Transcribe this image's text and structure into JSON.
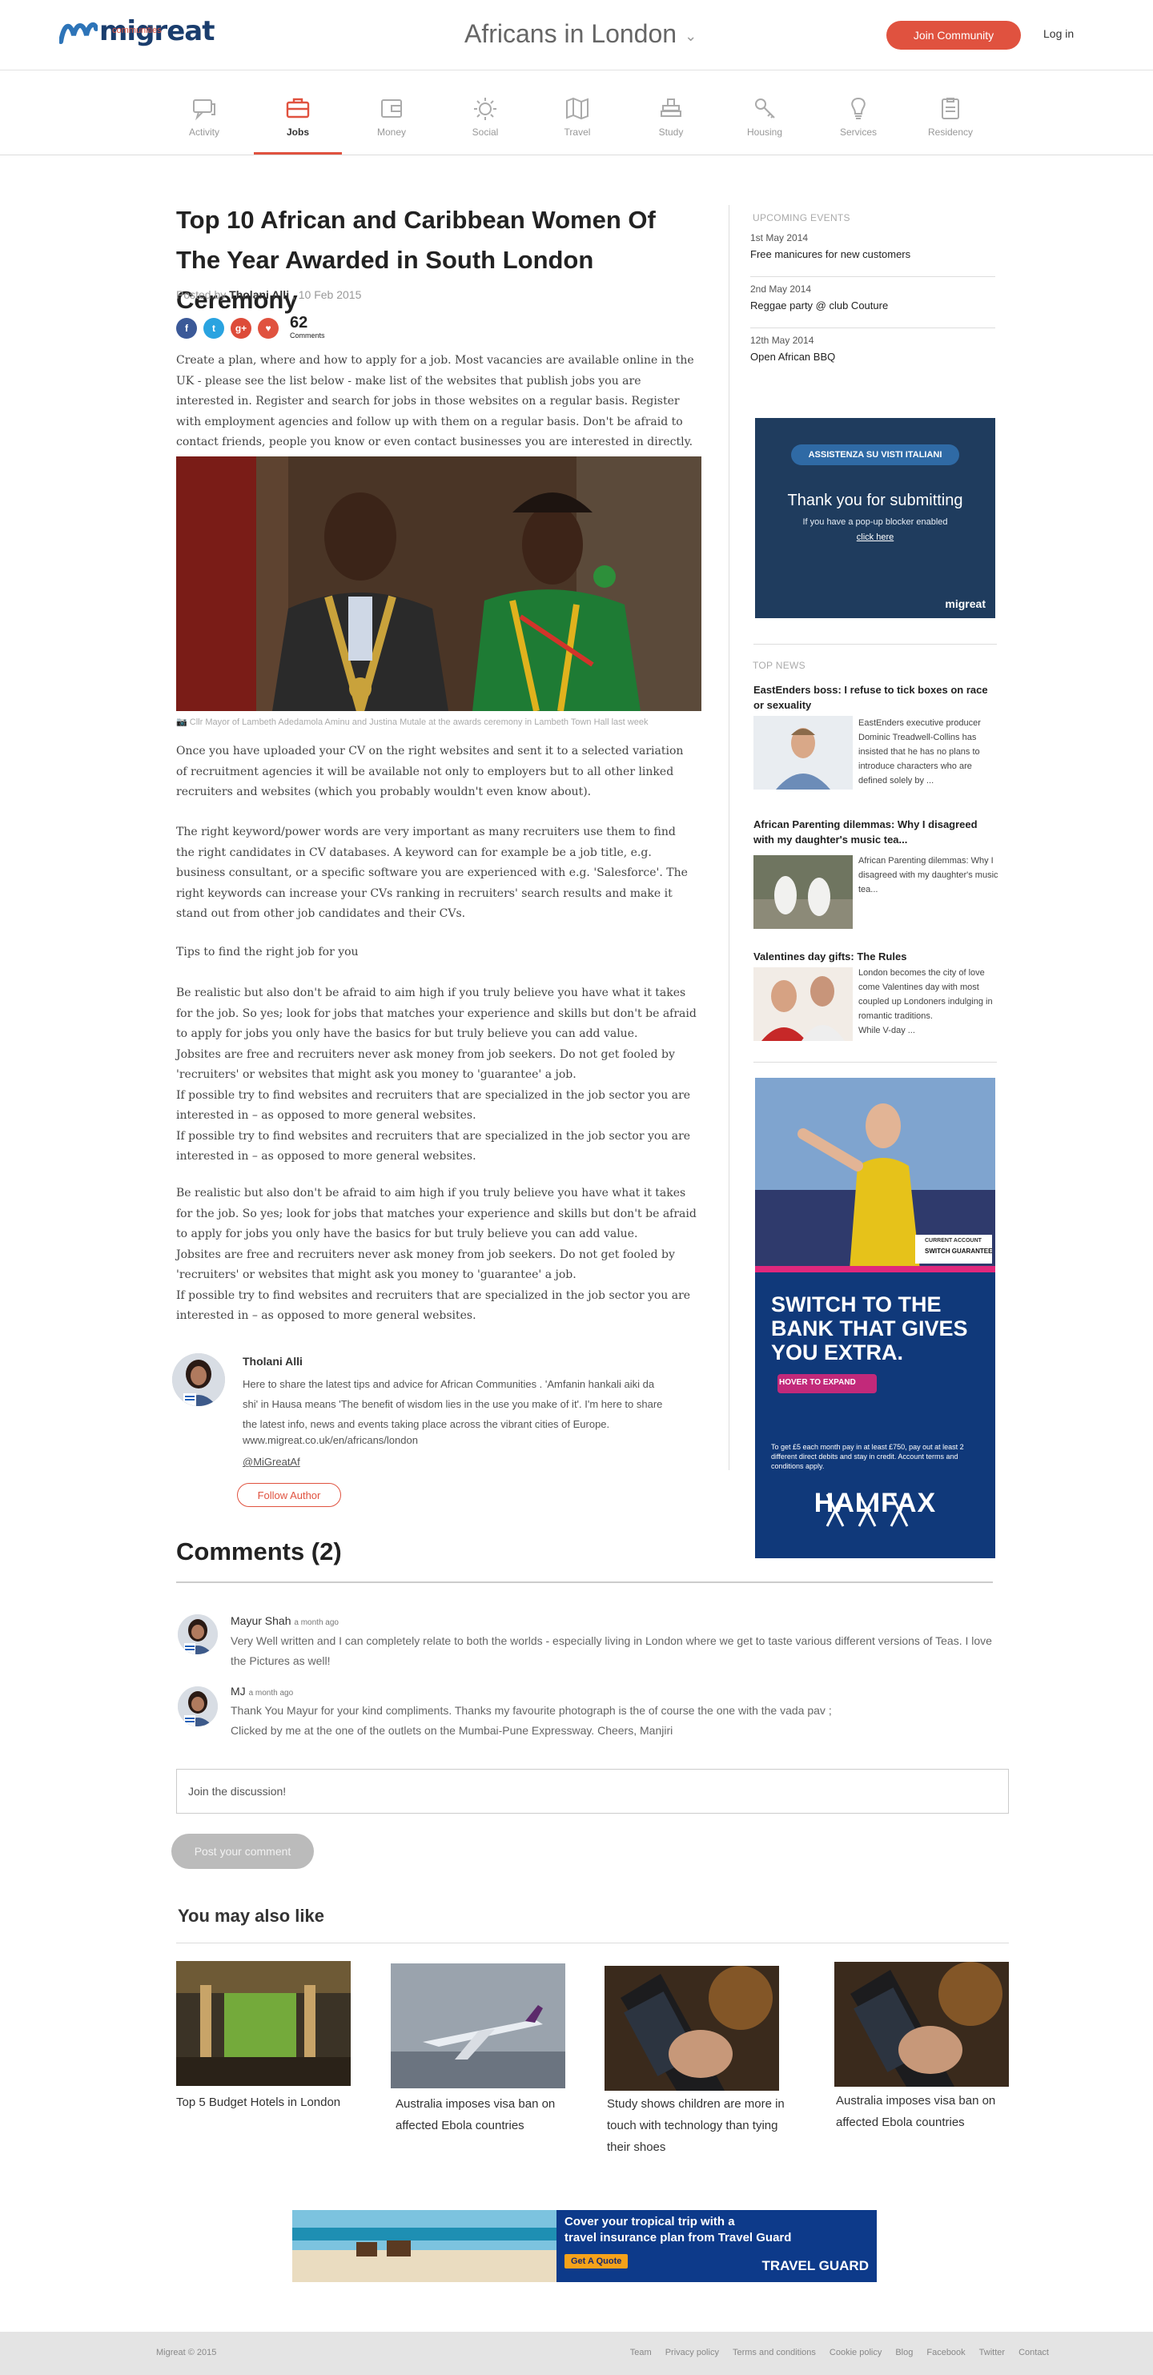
{
  "brand": {
    "logo": "migreat",
    "sub": "communities",
    "accent": "#e0523f",
    "navy": "#1a3d6d"
  },
  "header": {
    "city": "Africans in London",
    "join": "Join Community",
    "login": "Log in"
  },
  "categories": [
    {
      "label": "Activity",
      "icon": "chat-icon"
    },
    {
      "label": "Jobs",
      "icon": "briefcase-icon",
      "active": true
    },
    {
      "label": "Money",
      "icon": "wallet-icon"
    },
    {
      "label": "Social",
      "icon": "sun-icon"
    },
    {
      "label": "Travel",
      "icon": "map-icon"
    },
    {
      "label": "Study",
      "icon": "books-icon"
    },
    {
      "label": "Housing",
      "icon": "key-icon"
    },
    {
      "label": "Services",
      "icon": "bulb-icon"
    },
    {
      "label": "Residency",
      "icon": "clipboard-icon"
    }
  ],
  "article": {
    "title": "Top 10 African and Caribbean Women Of The Year Awarded in South London Ceremony",
    "posted_by": "Posted by ",
    "author": "Tholani Alli",
    "date": "10 Feb 2015",
    "comment_count": "62",
    "comments_label": "Comments",
    "intro": "Create a plan, where and how to apply for a job. Most vacancies are available online in the UK - please see the list below - make list of the websites that publish jobs you are interested in. Register and search for jobs in those websites on a regular basis. Register with employment agencies and follow up with them on a regular basis. Don't be afraid to contact friends, people you know or even contact businesses you are interested in directly.",
    "caption": "Cllr Mayor of Lambeth Adedamola Aminu and Justina Mutale at the awards ceremony in Lambeth Town Hall last week",
    "p1": "Once you have uploaded your CV on the right websites and sent it to a selected variation of recruitment agencies it will be available not only to employers but to all other linked recruiters and websites (which you probably wouldn't even know about).",
    "p2": "The right keyword/power words are very important as many recruiters use them to find the right candidates in CV databases. A keyword can for example be a job title, e.g. business consultant, or a specific software you are experienced with e.g. 'Salesforce'. The right keywords can increase your CVs ranking in recruiters' search results and make it stand out from other job candidates and their CVs.",
    "p3": "Tips to find the right job for you",
    "p4": "Be realistic but also don't be afraid to aim high if you truly believe you have what it takes for the job. So yes; look for jobs that matches your experience and skills but don't be afraid to apply for jobs you only have the basics for but truly believe you can add value.\nJobsites are free and recruiters never ask money from job seekers. Do not get fooled by 'recruiters' or websites that might ask you money to 'guarantee' a job.\nIf possible try to find websites and recruiters that are specialized in the job sector you are interested in – as opposed to more general websites.\nIf possible try to find websites and recruiters that are specialized in the job sector you are interested in – as opposed to more general websites.",
    "p5": "Be realistic but also don't be afraid to aim high if you truly believe you have what it takes for the job. So yes; look for jobs that matches your experience and skills but don't be afraid to apply for jobs you only have the basics for but truly believe you can add value.\nJobsites are free and recruiters never ask money from job seekers. Do not get fooled by 'recruiters' or websites that might ask you money to 'guarantee' a job.\nIf possible try to find websites and recruiters that are specialized in the job sector you are interested in – as opposed to more general websites."
  },
  "author_box": {
    "name": "Tholani Alli",
    "bio": "Here to share the latest tips and advice for African Communities . 'Amfanin hankali aiki da shi' in Hausa means 'The benefit of wisdom lies in the use you make of it'. I'm here to share the latest info, news and events taking place across the vibrant cities of Europe.",
    "link": "www.migreat.co.uk/en/africans/london",
    "twitter": "@MiGreatAf",
    "follow": "Follow Author"
  },
  "sidebar": {
    "events_heading": "UPCOMING EVENTS",
    "events": [
      {
        "date": "1st May 2014",
        "title": "Free manicures for new customers"
      },
      {
        "date": "2nd May 2014",
        "title": "Reggae party @ club Couture"
      },
      {
        "date": "12th May 2014",
        "title": "Open African BBQ"
      }
    ],
    "ad1": {
      "pill": "ASSISTENZA SU VISTI ITALIANI",
      "thanks": "Thank you for submitting",
      "popup": "If you have a pop-up blocker enabled",
      "click": "click here",
      "brand": "migreat"
    },
    "news_heading": "TOP NEWS",
    "news": [
      {
        "title": "EastEnders boss: I refuse to tick boxes on race or sexuality",
        "text": "EastEnders executive producer Dominic Treadwell-Collins has  insisted that he has no plans to introduce characters who are defined solely by ..."
      },
      {
        "title": "African Parenting dilemmas: Why I disagreed with my daughter's music tea...",
        "text": "African Parenting dilemmas: Why I disagreed with my daughter's music tea..."
      },
      {
        "title": "Valentines day gifts: The Rules",
        "text": "London becomes the city of love come Valentines day with most  coupled up Londoners indulging in romantic traditions.\nWhile V-day ..."
      }
    ],
    "ad2": {
      "badge1": "CURRENT ACCOUNT",
      "badge2": "SWITCH GUARANTEE",
      "headline": "SWITCH TO THE BANK THAT GIVES YOU EXTRA.",
      "hover": "HOVER TO EXPAND",
      "fine": "To get £5 each month pay in at least £750, pay out at least 2 different direct debits and stay in credit. Account terms and conditions apply.",
      "brand": "HALIFAX"
    }
  },
  "comments": {
    "heading": "Comments (2)",
    "items": [
      {
        "name": "Mayur Shah",
        "ago": "a month ago",
        "text": "Very Well written and I can completely relate to both the worlds - especially living in London where we get to taste various different versions of Teas. I love the Pictures as well!"
      },
      {
        "name": "MJ",
        "ago": "a month ago",
        "text": "Thank You Mayur for your kind compliments. Thanks my favourite photograph is the of course the one with the vada pav ;\nClicked by me at the one of the outlets on the Mumbai-Pune Expressway. Cheers, Manjiri"
      }
    ],
    "placeholder": "Join the discussion!",
    "post": "Post your comment"
  },
  "related": {
    "heading": "You may also like",
    "items": [
      {
        "title": "Top 5 Budget Hotels in London"
      },
      {
        "title": "Australia imposes visa ban on affected Ebola countries"
      },
      {
        "title": "Study shows children are more in touch with technology than tying their shoes"
      },
      {
        "title": "Australia imposes visa ban on affected Ebola countries"
      }
    ]
  },
  "banner": {
    "line1": "Cover your tropical trip with a",
    "line2": "travel insurance plan from Travel Guard",
    "cta": "Get A Quote",
    "brand": "TRAVEL GUARD"
  },
  "footer": {
    "copy": "Migreat © 2015",
    "links": [
      "Team",
      "Privacy policy",
      "Terms and conditions",
      "Cookie policy",
      "Blog",
      "Facebook",
      "Twitter",
      "Contact"
    ]
  }
}
